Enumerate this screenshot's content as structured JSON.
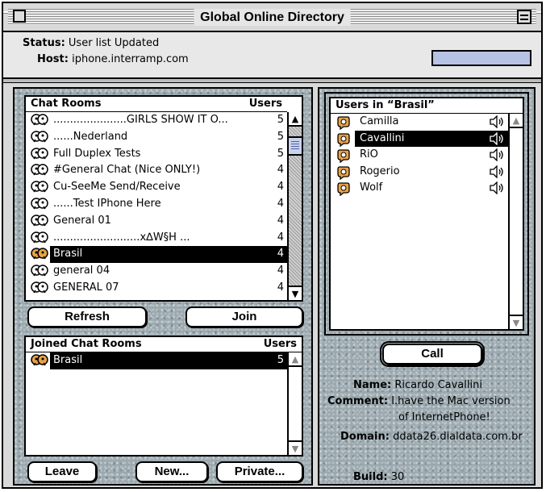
{
  "window": {
    "title": "Global Online Directory"
  },
  "header": {
    "status_label": "Status",
    "status_value": "User list Updated",
    "host_label": "Host",
    "host_value": "iphone.interramp.com",
    "indicator_color": "#b7c3e5"
  },
  "chat_rooms": {
    "col_name": "Chat Rooms",
    "col_users": "Users",
    "rows": [
      {
        "name": "......................GIRLS SHOW IT O...",
        "users": "5",
        "selected": false
      },
      {
        "name": "......Nederland",
        "users": "5",
        "selected": false
      },
      {
        "name": "Full Duplex Tests",
        "users": "5",
        "selected": false
      },
      {
        "name": "#General Chat (Nice ONLY!)",
        "users": "4",
        "selected": false
      },
      {
        "name": "Cu-SeeMe Send/Receive",
        "users": "4",
        "selected": false
      },
      {
        "name": "......Test IPhone Here",
        "users": "4",
        "selected": false
      },
      {
        "name": "General 01",
        "users": "4",
        "selected": false
      },
      {
        "name": "..........................x∆W§H          ...",
        "users": "4",
        "selected": false
      },
      {
        "name": "Brasil",
        "users": "4",
        "selected": true
      },
      {
        "name": "general 04",
        "users": "4",
        "selected": false
      },
      {
        "name": "GENERAL 07",
        "users": "4",
        "selected": false
      }
    ]
  },
  "buttons": {
    "refresh": "Refresh",
    "join": "Join",
    "leave": "Leave",
    "new": "New...",
    "private": "Private...",
    "call": "Call"
  },
  "joined_rooms": {
    "col_name": "Joined Chat Rooms",
    "col_users": "Users",
    "rows": [
      {
        "name": "Brasil",
        "users": "5",
        "selected": true
      }
    ]
  },
  "users_panel": {
    "title": "Users in “Brasil”",
    "users": [
      {
        "name": "Camilla",
        "selected": false
      },
      {
        "name": "Cavallini",
        "selected": true
      },
      {
        "name": "RiO",
        "selected": false
      },
      {
        "name": "Rogerio",
        "selected": false
      },
      {
        "name": "Wolf",
        "selected": false
      }
    ]
  },
  "user_info": {
    "name_label": "Name",
    "name_value": "Ricardo Cavallini",
    "comment_label": "Comment",
    "comment_value_1": "I.have the Mac version",
    "comment_value_2": "of InternetPhone!",
    "domain_label": "Domain",
    "domain_value": "ddata26.dialdata.com.br",
    "build_label": "Build",
    "build_value": "30"
  }
}
